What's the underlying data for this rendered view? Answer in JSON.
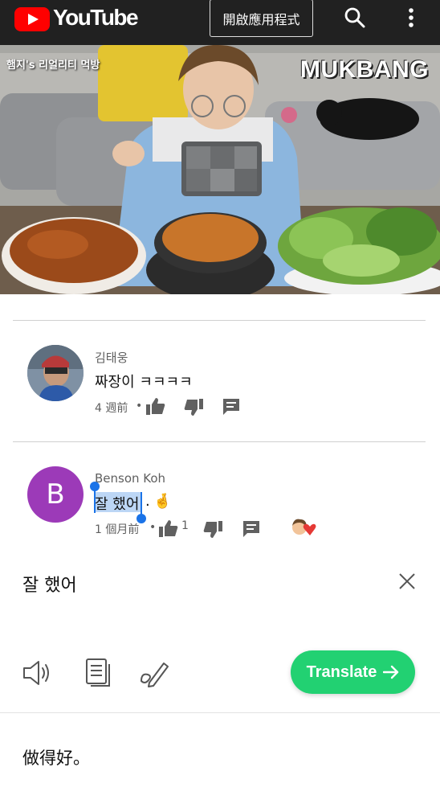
{
  "header": {
    "logo_text": "YouTube",
    "open_app_label": "開啟應用程式",
    "icons": [
      "youtube-logo-icon",
      "search-icon",
      "more-vert-icon"
    ],
    "brand_color": "#ff0000"
  },
  "video": {
    "overlay_title": "햄지's 리얼리티 먹방",
    "overlay_tag": "MUKBANG"
  },
  "comments": [
    {
      "author": "김태웅",
      "text": "짜장이 ㅋㅋㅋㅋ",
      "time": "4 週前",
      "separator": "•"
    },
    {
      "author": "Benson Koh",
      "avatar_letter": "B",
      "avatar_color": "#9c3ab8",
      "text_selected": "잘 했어",
      "text_rest": ".",
      "emoji": "🤞",
      "time": "1 個月前",
      "separator": "•",
      "like_count": "1"
    }
  ],
  "translate": {
    "source_text": "잘 했어",
    "button_label": "Translate",
    "result_text": "做得好。",
    "accent_color": "#22d172",
    "tool_icons": [
      "speaker-icon",
      "copy-icon",
      "edit-icon"
    ]
  }
}
